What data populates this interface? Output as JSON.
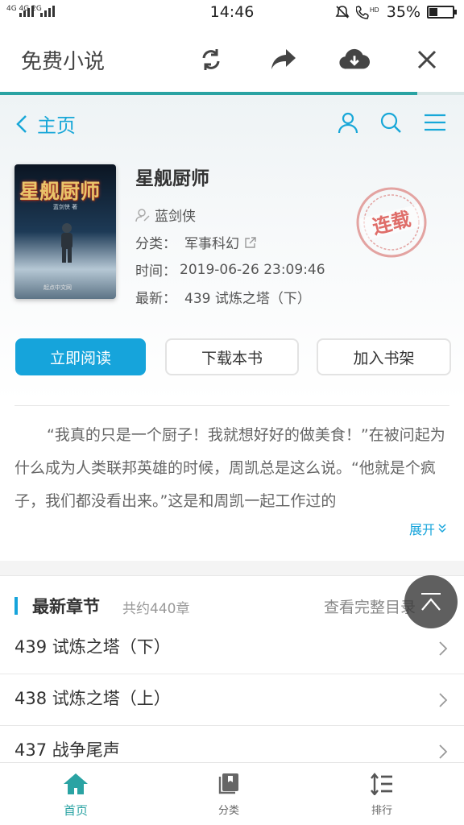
{
  "status_bar": {
    "network": "4G 4G 2G",
    "time": "14:46",
    "battery": "35%",
    "battery_level": 0.35
  },
  "app": {
    "title": "免费小说",
    "load_progress": 0.9
  },
  "nav": {
    "back_label": "主页"
  },
  "book": {
    "title": "星舰厨师",
    "author": "蓝剑侠",
    "category_label": "分类：",
    "category": "军事科幻",
    "time_label": "时间：",
    "updated": "2019-06-26 23:09:46",
    "latest_label": "最新：",
    "latest": "439 试炼之塔（下）",
    "status_stamp": "连载",
    "cover_title": "星舰厨师",
    "cover_author": "蓝剑侠 著",
    "cover_publisher": "起点中文网"
  },
  "actions": {
    "read": "立即阅读",
    "download": "下载本书",
    "add_shelf": "加入书架"
  },
  "description": {
    "text": "“我真的只是一个厨子！我就想好好的做美食！”在被问起为什么成为人类联邦英雄的时候，周凯总是这么说。“他就是个疯子，我们都没看出来。”这是和周凯一起工作过的",
    "expand": "展开"
  },
  "chapters": {
    "heading": "最新章节",
    "count": "共约440章",
    "view_all": "查看完整目录",
    "items": [
      {
        "title": "439 试炼之塔（下）"
      },
      {
        "title": "438 试炼之塔（上）"
      },
      {
        "title": "437 战争尾声"
      }
    ]
  },
  "bottom_nav": {
    "tabs": [
      {
        "label": "首页"
      },
      {
        "label": "分类"
      },
      {
        "label": "排行"
      }
    ]
  },
  "colors": {
    "accent": "#16a4db",
    "teal": "#2aa3a3",
    "stamp_red": "#d9534f"
  }
}
